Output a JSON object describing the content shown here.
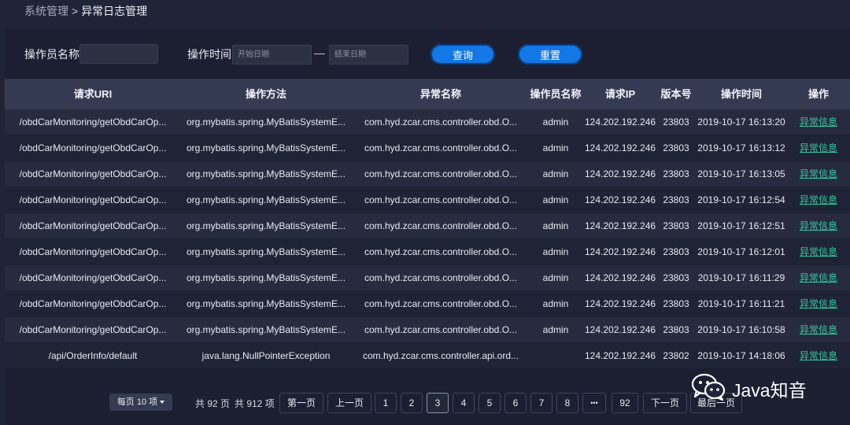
{
  "breadcrumb": {
    "root": "系统管理",
    "separator": ">",
    "current": "异常日志管理"
  },
  "filters": {
    "operator_label": "操作员名称",
    "operator_value": "",
    "time_label": "操作时间",
    "start_placeholder": "开始日期",
    "end_placeholder": "结束日期",
    "dash": "—",
    "query_label": "查询",
    "reset_label": "重置"
  },
  "table": {
    "headers": [
      "请求URI",
      "操作方法",
      "异常名称",
      "操作员名称",
      "请求IP",
      "版本号",
      "操作时间",
      "操作"
    ],
    "rows": [
      [
        "/obdCarMonitoring/getObdCarOp...",
        "org.mybatis.spring.MyBatisSystemE...",
        "com.hyd.zcar.cms.controller.obd.O...",
        "admin",
        "124.202.192.246",
        "23803",
        "2019-10-17 16:13:20",
        "异常信息"
      ],
      [
        "/obdCarMonitoring/getObdCarOp...",
        "org.mybatis.spring.MyBatisSystemE...",
        "com.hyd.zcar.cms.controller.obd.O...",
        "admin",
        "124.202.192.246",
        "23803",
        "2019-10-17 16:13:12",
        "异常信息"
      ],
      [
        "/obdCarMonitoring/getObdCarOp...",
        "org.mybatis.spring.MyBatisSystemE...",
        "com.hyd.zcar.cms.controller.obd.O...",
        "admin",
        "124.202.192.246",
        "23803",
        "2019-10-17 16:13:05",
        "异常信息"
      ],
      [
        "/obdCarMonitoring/getObdCarOp...",
        "org.mybatis.spring.MyBatisSystemE...",
        "com.hyd.zcar.cms.controller.obd.O...",
        "admin",
        "124.202.192.246",
        "23803",
        "2019-10-17 16:12:54",
        "异常信息"
      ],
      [
        "/obdCarMonitoring/getObdCarOp...",
        "org.mybatis.spring.MyBatisSystemE...",
        "com.hyd.zcar.cms.controller.obd.O...",
        "admin",
        "124.202.192.246",
        "23803",
        "2019-10-17 16:12:51",
        "异常信息"
      ],
      [
        "/obdCarMonitoring/getObdCarOp...",
        "org.mybatis.spring.MyBatisSystemE...",
        "com.hyd.zcar.cms.controller.obd.O...",
        "admin",
        "124.202.192.246",
        "23803",
        "2019-10-17 16:12:01",
        "异常信息"
      ],
      [
        "/obdCarMonitoring/getObdCarOp...",
        "org.mybatis.spring.MyBatisSystemE...",
        "com.hyd.zcar.cms.controller.obd.O...",
        "admin",
        "124.202.192.246",
        "23803",
        "2019-10-17 16:11:29",
        "异常信息"
      ],
      [
        "/obdCarMonitoring/getObdCarOp...",
        "org.mybatis.spring.MyBatisSystemE...",
        "com.hyd.zcar.cms.controller.obd.O...",
        "admin",
        "124.202.192.246",
        "23803",
        "2019-10-17 16:11:21",
        "异常信息"
      ],
      [
        "/obdCarMonitoring/getObdCarOp...",
        "org.mybatis.spring.MyBatisSystemE...",
        "com.hyd.zcar.cms.controller.obd.O...",
        "admin",
        "124.202.192.246",
        "23803",
        "2019-10-17 16:10:58",
        "异常信息"
      ],
      [
        "/api/OrderInfo/default",
        "java.lang.NullPointerException",
        "com.hyd.zcar.cms.controller.api.ord...",
        "",
        "124.202.192.246",
        "23802",
        "2019-10-17 14:18:06",
        "异常信息"
      ]
    ]
  },
  "pagination": {
    "page_size_label": "每页 10 项",
    "total_pages_text": "共 92 页",
    "total_items_text": "共 912 项",
    "first_label": "第一页",
    "prev_label": "上一页",
    "pages": [
      "1",
      "2",
      "3",
      "4",
      "5",
      "6",
      "7",
      "8",
      "•••",
      "92"
    ],
    "current_page": "3",
    "next_label": "下一页",
    "last_label": "最后一页"
  },
  "watermark": {
    "text": "Java知音",
    "icon": "wechat-icon"
  },
  "colors": {
    "accent": "#1477e6",
    "link": "#37c9a0",
    "background": "#202438",
    "header": "#343a52"
  }
}
